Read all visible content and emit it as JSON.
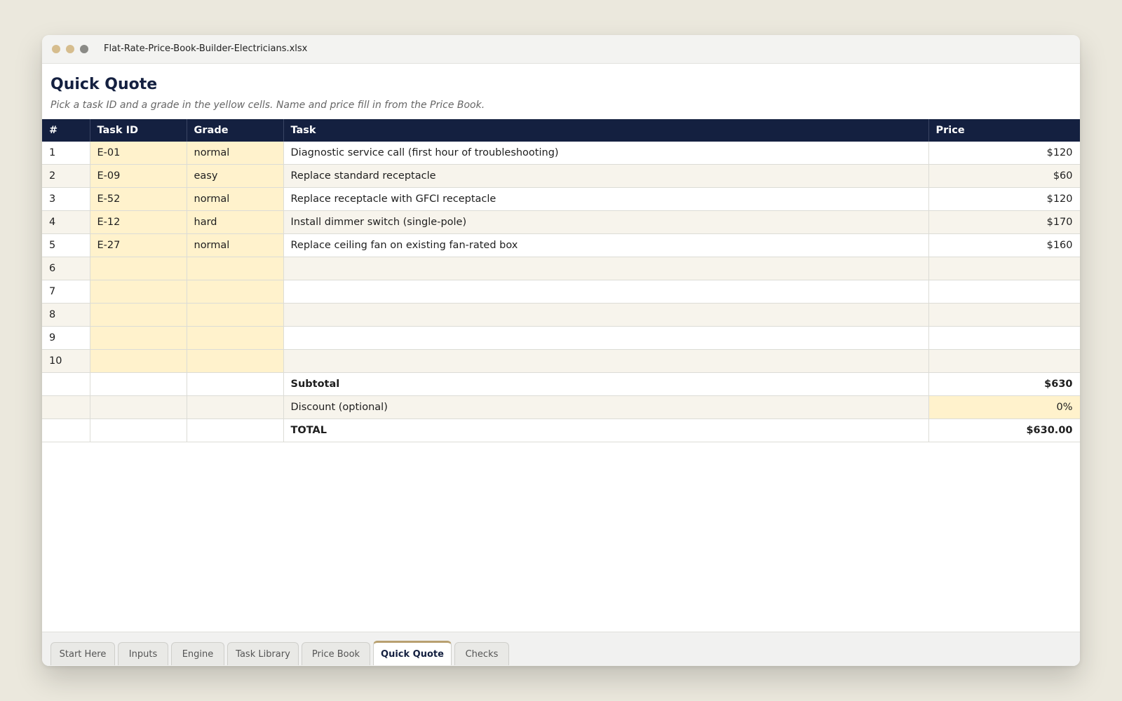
{
  "window": {
    "filename": "Flat-Rate-Price-Book-Builder-Electricians.xlsx"
  },
  "sheet": {
    "title": "Quick Quote",
    "subtitle": "Pick a task ID and a grade in the yellow cells. Name and price fill in from the Price Book."
  },
  "table": {
    "headers": {
      "num": "#",
      "task_id": "Task ID",
      "grade": "Grade",
      "task": "Task",
      "price": "Price"
    },
    "rows": [
      {
        "num": "1",
        "task_id": "E-01",
        "grade": "normal",
        "task": "Diagnostic service call (first hour of troubleshooting)",
        "price": "$120"
      },
      {
        "num": "2",
        "task_id": "E-09",
        "grade": "easy",
        "task": "Replace standard receptacle",
        "price": "$60"
      },
      {
        "num": "3",
        "task_id": "E-52",
        "grade": "normal",
        "task": "Replace receptacle with GFCI receptacle",
        "price": "$120"
      },
      {
        "num": "4",
        "task_id": "E-12",
        "grade": "hard",
        "task": "Install dimmer switch (single-pole)",
        "price": "$170"
      },
      {
        "num": "5",
        "task_id": "E-27",
        "grade": "normal",
        "task": "Replace ceiling fan on existing fan-rated box",
        "price": "$160"
      },
      {
        "num": "6",
        "task_id": "",
        "grade": "",
        "task": "",
        "price": ""
      },
      {
        "num": "7",
        "task_id": "",
        "grade": "",
        "task": "",
        "price": ""
      },
      {
        "num": "8",
        "task_id": "",
        "grade": "",
        "task": "",
        "price": ""
      },
      {
        "num": "9",
        "task_id": "",
        "grade": "",
        "task": "",
        "price": ""
      },
      {
        "num": "10",
        "task_id": "",
        "grade": "",
        "task": "",
        "price": ""
      }
    ],
    "summary": {
      "subtotal_label": "Subtotal",
      "subtotal_value": "$630",
      "discount_label": "Discount (optional)",
      "discount_value": "0%",
      "total_label": "TOTAL",
      "total_value": "$630.00"
    }
  },
  "tabs": [
    "Start Here",
    "Inputs",
    "Engine",
    "Task Library",
    "Price Book",
    "Quick Quote",
    "Checks"
  ],
  "active_tab": "Quick Quote",
  "colors": {
    "header": "#142040",
    "input_cell": "#fff2cc",
    "stripe": "#f7f4ec"
  }
}
